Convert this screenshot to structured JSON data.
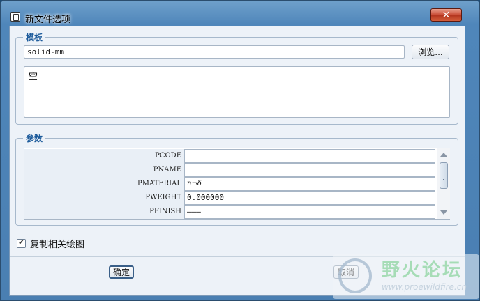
{
  "window": {
    "title": "新文件选项",
    "close_icon": "✕"
  },
  "template_group": {
    "legend": "模板",
    "template_value": "solid-mm",
    "browse_label": "浏览...",
    "description": "空"
  },
  "params_group": {
    "legend": "参数",
    "rows": [
      {
        "name": "PCODE",
        "value": ""
      },
      {
        "name": "PNAME",
        "value": ""
      },
      {
        "name": "PMATERIAL",
        "value": "  n¬δ"
      },
      {
        "name": "PWEIGHT",
        "value": "0.000000"
      },
      {
        "name": "PFINISH",
        "value": "———"
      }
    ]
  },
  "copy_drawing": {
    "label": "复制相关绘图",
    "checked": true
  },
  "buttons": {
    "ok_label": "确定",
    "cancel_label": "取消"
  },
  "watermark": {
    "text": "野火论坛",
    "url": "www.proewildfire.cn"
  }
}
